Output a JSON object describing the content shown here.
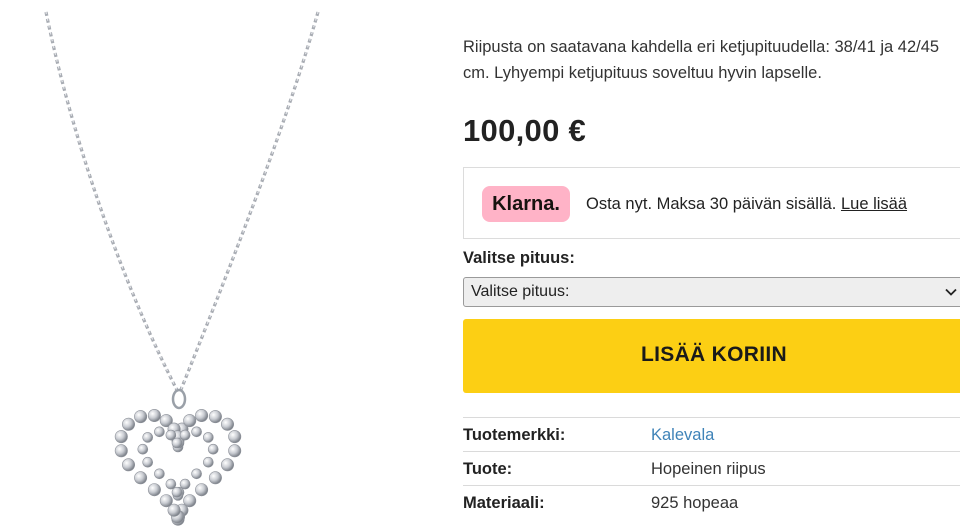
{
  "product": {
    "image_alt": "Hopeinen sydänriipus ketjussa",
    "description": "Riipusta on saatavana kahdella eri ketjupituudella: 38/41 ja 42/45 cm. Lyhyempi ketjupituus soveltuu hyvin lapselle.",
    "price": "100,00 €"
  },
  "klarna": {
    "logo": "Klarna.",
    "text": "Osta nyt. Maksa 30 päivän sisällä.",
    "link": "Lue lisää",
    "brand_color": "#ffb3c7"
  },
  "length_select": {
    "label": "Valitse pituus:",
    "selected": "Valitse pituus:",
    "icon": "chevron-down-icon"
  },
  "cart": {
    "button_label": "LISÄÄ KORIIN",
    "button_color": "#fccf14"
  },
  "specs": [
    {
      "key": "Tuotemerkki:",
      "value": "Kalevala"
    },
    {
      "key": "Tuote:",
      "value": "Hopeinen riipus"
    },
    {
      "key": "Materiaali:",
      "value": "925 hopeaa"
    }
  ],
  "colors": {
    "link": "#3f83b8",
    "text": "#222222"
  }
}
